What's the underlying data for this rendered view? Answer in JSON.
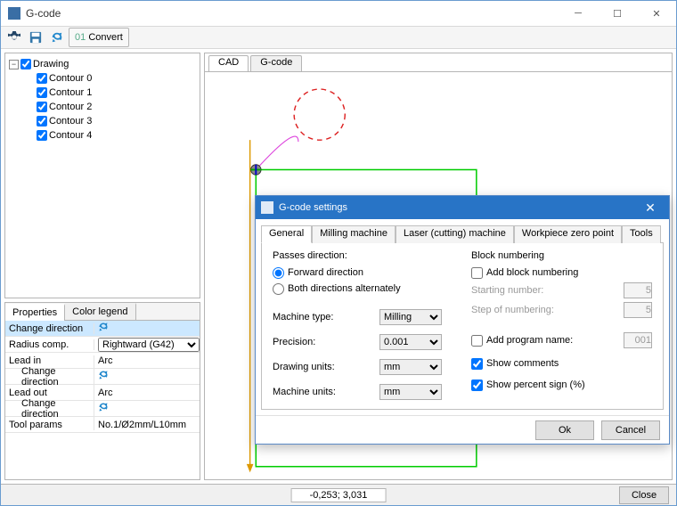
{
  "window": {
    "title": "G-code"
  },
  "toolbar": {
    "convert_label": "Convert"
  },
  "tree": {
    "root_label": "Drawing",
    "items": [
      {
        "label": "Contour 0"
      },
      {
        "label": "Contour 1"
      },
      {
        "label": "Contour 2"
      },
      {
        "label": "Contour 3"
      },
      {
        "label": "Contour 4"
      }
    ]
  },
  "props": {
    "tabs": {
      "properties": "Properties",
      "legend": "Color legend"
    },
    "rows": {
      "change_dir": "Change direction",
      "radius_comp": "Radius comp.",
      "radius_comp_val": "Rightward (G42)",
      "lead_in": "Lead in",
      "lead_in_val": "Arc",
      "lead_out": "Lead out",
      "lead_out_val": "Arc",
      "tool_params": "Tool params",
      "tool_params_val": "No.1/Ø2mm/L10mm"
    }
  },
  "cad": {
    "tabs": {
      "cad": "CAD",
      "gcode": "G-code"
    }
  },
  "status": {
    "coords": "-0,253; 3,031",
    "close_label": "Close"
  },
  "dialog": {
    "title": "G-code settings",
    "tabs": {
      "general": "General",
      "milling": "Milling machine",
      "laser": "Laser (cutting) machine",
      "workpiece": "Workpiece zero point",
      "tools": "Tools"
    },
    "passes": {
      "title": "Passes direction:",
      "forward": "Forward direction",
      "both": "Both directions alternately"
    },
    "fields": {
      "machine_type": "Machine type:",
      "machine_type_val": "Milling",
      "precision": "Precision:",
      "precision_val": "0.001",
      "drawing_units": "Drawing units:",
      "drawing_units_val": "mm",
      "machine_units": "Machine units:",
      "machine_units_val": "mm"
    },
    "block": {
      "title": "Block numbering",
      "add": "Add block numbering",
      "starting": "Starting number:",
      "starting_val": "5",
      "step": "Step of numbering:",
      "step_val": "5"
    },
    "add_program": "Add program name:",
    "add_program_val": "001",
    "show_comments": "Show comments",
    "show_percent": "Show percent sign (%)",
    "ok": "Ok",
    "cancel": "Cancel"
  }
}
